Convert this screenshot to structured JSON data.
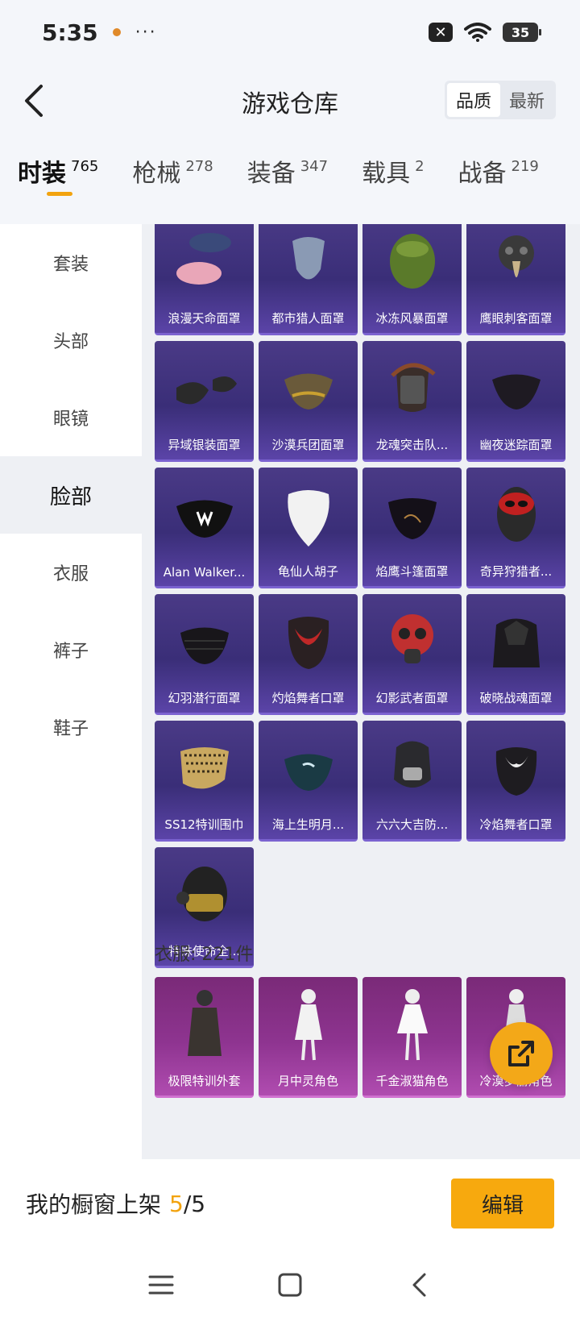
{
  "status": {
    "time": "5:35",
    "more": "···",
    "battery": "35"
  },
  "header": {
    "title": "游戏仓库",
    "sort_options": [
      "品质",
      "最新"
    ],
    "sort_active": 0
  },
  "tabs": [
    {
      "label": "时装",
      "count": "765"
    },
    {
      "label": "枪械",
      "count": "278"
    },
    {
      "label": "装备",
      "count": "347"
    },
    {
      "label": "载具",
      "count": "2"
    },
    {
      "label": "战备",
      "count": "219"
    }
  ],
  "sidebar": [
    "套装",
    "头部",
    "眼镜",
    "脸部",
    "衣服",
    "裤子",
    "鞋子"
  ],
  "face_items": [
    "浪漫天命面罩",
    "都市猎人面罩",
    "冰冻风暴面罩",
    "鹰眼刺客面罩",
    "异域银装面罩",
    "沙漠兵团面罩",
    "龙魂突击队...",
    "幽夜迷踪面罩",
    "Alan Walker...",
    "龟仙人胡子",
    "焰鹰斗篷面罩",
    "奇异狩猎者...",
    "幻羽潜行面罩",
    "灼焰舞者口罩",
    "幻影武者面罩",
    "破晓战魂面罩",
    "SS12特训围巾",
    "海上生明月...",
    "六六大吉防...",
    "冷焰舞者口罩",
    "特殊使命全..."
  ],
  "clothes_section": {
    "title": "衣服: 221件"
  },
  "clothes_items": [
    "极限特训外套",
    "月中灵角色",
    "千金淑猫角色",
    "冷漠罗丽角色"
  ],
  "bottom": {
    "shelf_label": "我的橱窗上架",
    "shelf_current": "5",
    "shelf_total": "/5",
    "edit": "编辑"
  },
  "colors": {
    "accent": "#f2a30f",
    "card_purple": "#3a2e78",
    "card_pink": "#8e3490"
  }
}
